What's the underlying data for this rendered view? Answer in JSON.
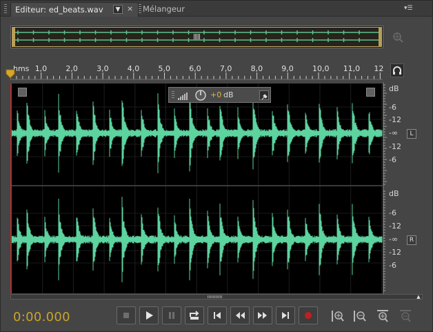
{
  "tabs": {
    "editor_label": "Editeur: ed_beats.wav",
    "editor_dropdown_glyph": "▼",
    "editor_close_glyph": "×",
    "mixer_label": "Mélangeur",
    "panel_menu_glyph": "▾☰"
  },
  "ruler": {
    "unit": "hms",
    "ticks": [
      "1,0",
      "2,0",
      "3,0",
      "4,0",
      "5,0",
      "6,0",
      "7,0",
      "8,0",
      "9,0",
      "10,0",
      "11,0",
      "12"
    ]
  },
  "hud": {
    "volume_value": "+0",
    "volume_unit": "dB"
  },
  "db_scale": {
    "left_channel": [
      "dB",
      "-6",
      "-12",
      "-∞",
      "-12",
      "-6"
    ],
    "right_channel": [
      "dB",
      "-6",
      "-12",
      "-∞",
      "-12",
      "-6"
    ],
    "left_button": "L",
    "right_button": "R"
  },
  "transport": {
    "timecode": "0:00.000"
  },
  "colors": {
    "waveform": "#5dd39f",
    "timecode": "#c9a42c",
    "record": "#c02020",
    "selection": "#c7b06a"
  },
  "icons": {
    "overview_zoom": "zoom-icon",
    "snap": "headphone-icon",
    "pin": "pin-icon",
    "stop": "stop-icon",
    "play": "play-icon",
    "pause": "pause-icon",
    "loop": "loop-icon",
    "go_start": "skip-start-icon",
    "rewind": "rewind-icon",
    "forward": "fast-forward-icon",
    "go_end": "skip-end-icon",
    "record": "record-icon"
  }
}
